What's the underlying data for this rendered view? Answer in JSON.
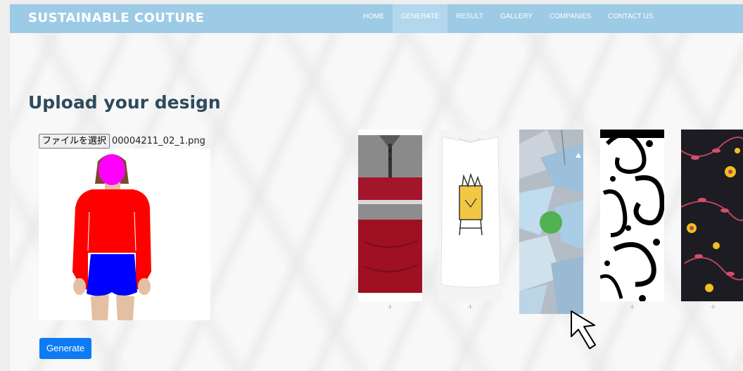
{
  "navbar": {
    "brand": "SUSTAINABLE COUTURE",
    "items": [
      {
        "label": "HOME"
      },
      {
        "label": "GENERATE",
        "active": true
      },
      {
        "label": "RESULT"
      },
      {
        "label": "GALLERY"
      },
      {
        "label": "COMPANIES"
      },
      {
        "label": "CONTACT US"
      }
    ]
  },
  "upload": {
    "heading": "Upload your design",
    "file_button_label": "ファイルを選択",
    "file_name": "00004211_02_1.png",
    "generate_label": "Generate"
  },
  "gallery": {
    "add_symbol": "+",
    "tiles": [
      {
        "name": "polo-shirt"
      },
      {
        "name": "graphic-tshirt"
      },
      {
        "name": "geometric-pattern",
        "selected": true
      },
      {
        "name": "paisley-pattern"
      },
      {
        "name": "floral-pattern"
      }
    ]
  },
  "colors": {
    "navbar": "#9dcbe6",
    "navbar_active": "#b3d7ec",
    "heading": "#2e4a5c",
    "button": "#0d7bf3",
    "plus": "#8fbfe0"
  }
}
